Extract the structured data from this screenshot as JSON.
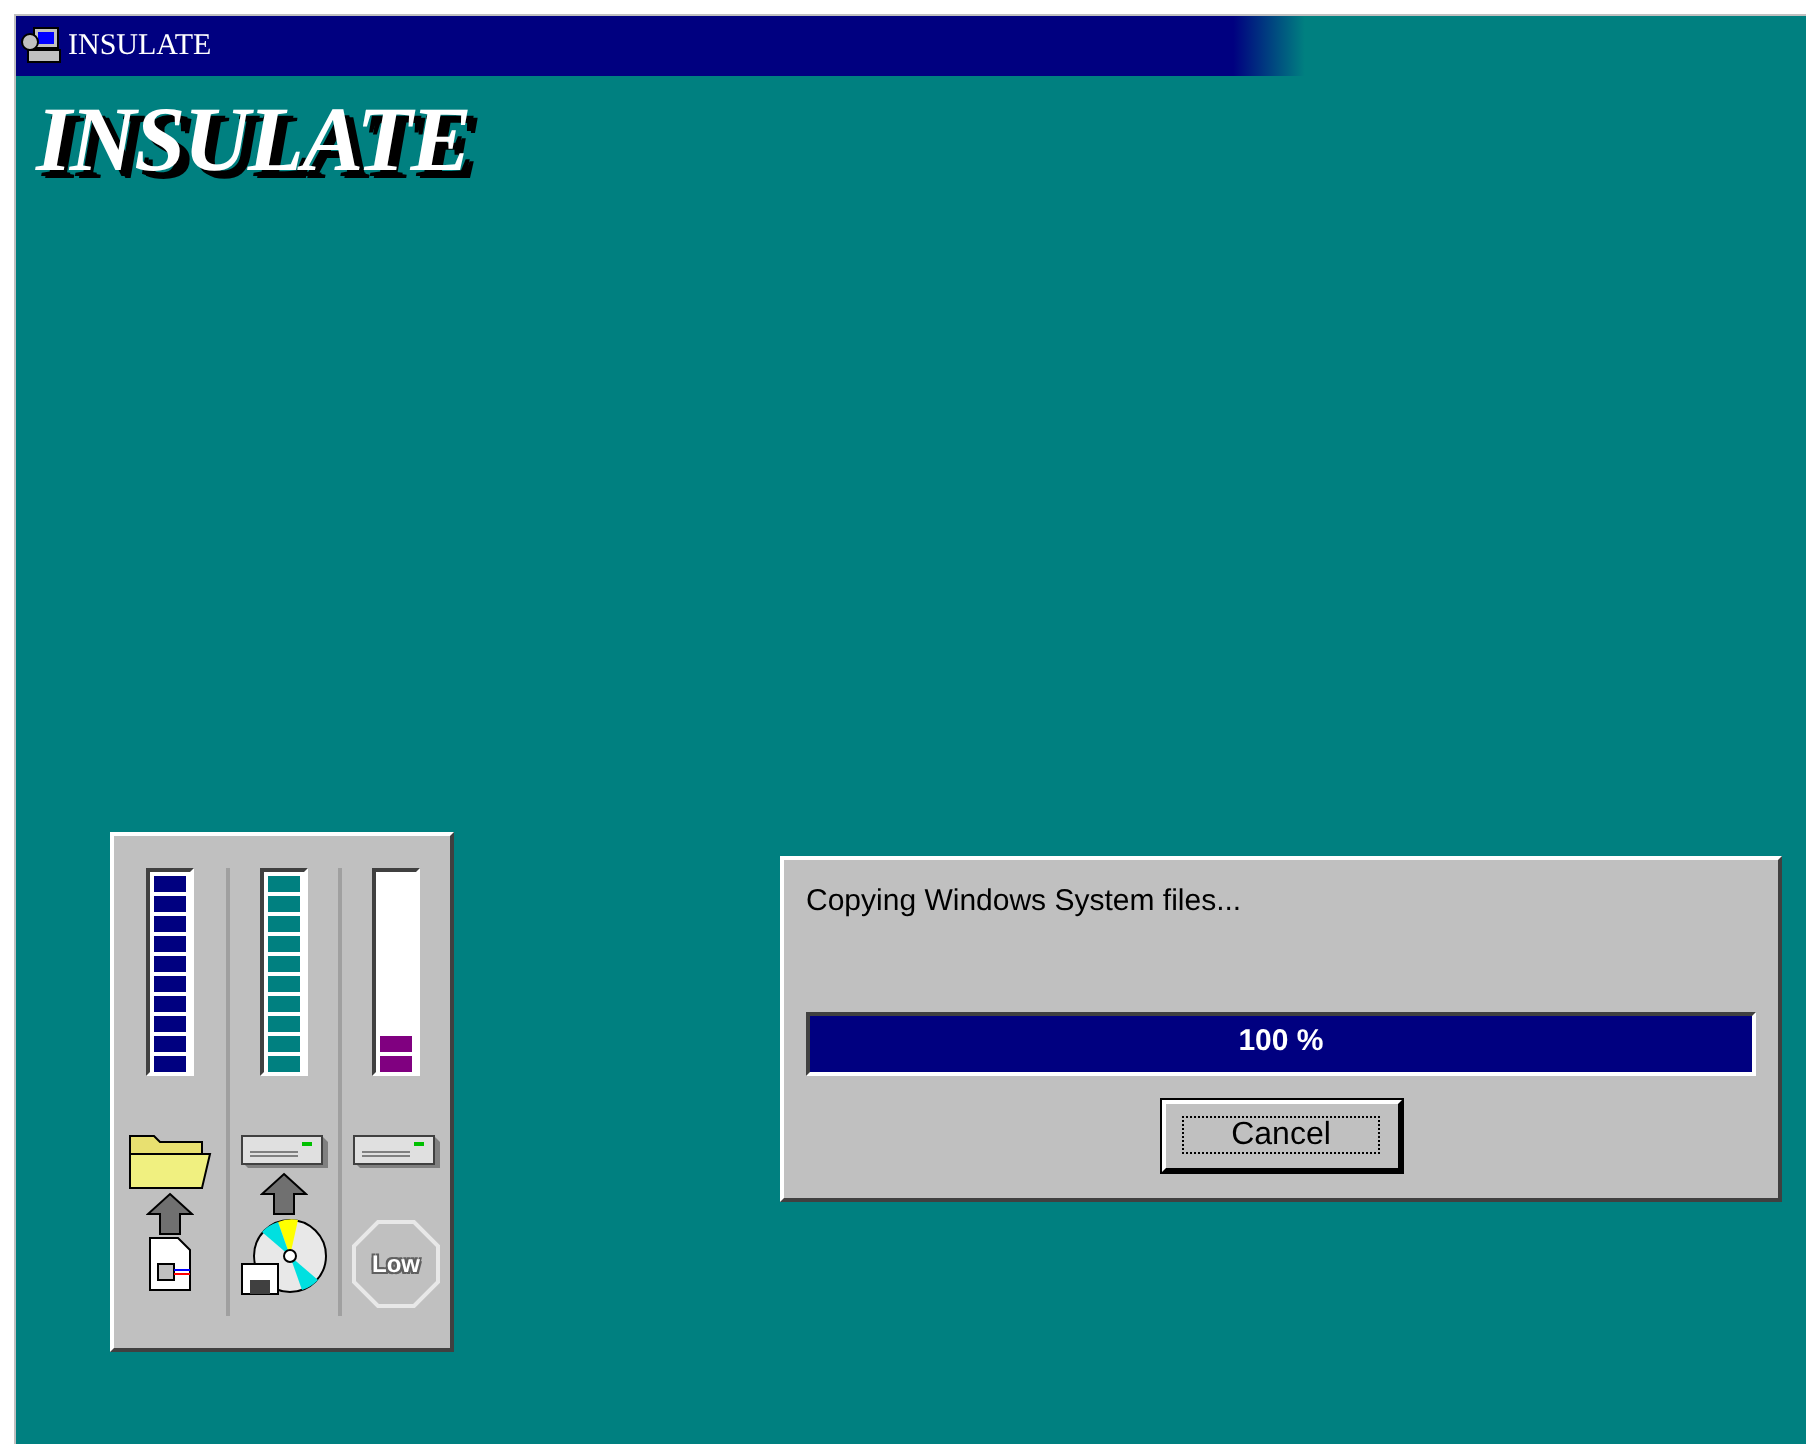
{
  "window": {
    "title": "INSULATE"
  },
  "logo": "INSULATE",
  "meters": [
    {
      "level": 1,
      "color": "#000080"
    },
    {
      "level": 1,
      "color": "#008080"
    },
    {
      "level": 0.2,
      "color": "#800080"
    }
  ],
  "low_sign": "Low",
  "dialog": {
    "message": "Copying Windows System files...",
    "progress": {
      "level": 1,
      "text": "100 %"
    },
    "button": "Cancel"
  }
}
